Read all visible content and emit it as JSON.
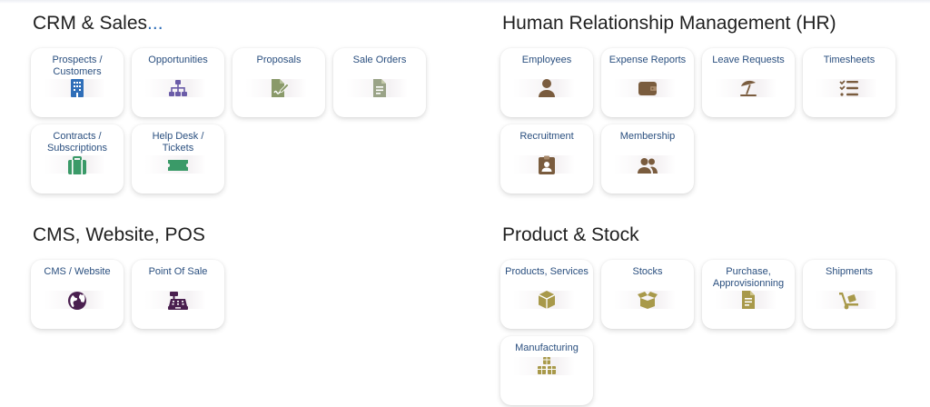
{
  "sections": {
    "crm": {
      "title": "CRM & Sales",
      "title_suffix": "...",
      "tiles": [
        {
          "label": "Prospects / Customers",
          "icon": "building-icon",
          "color": "#2f6eb8"
        },
        {
          "label": "Opportunities",
          "icon": "sitemap-icon",
          "color": "#6b5ca8"
        },
        {
          "label": "Proposals",
          "icon": "file-signature-icon",
          "color": "#8a9a6a"
        },
        {
          "label": "Sale Orders",
          "icon": "file-invoice-icon",
          "color": "#9aa387"
        },
        {
          "label": "Contracts / Subscriptions",
          "icon": "suitcase-icon",
          "color": "#3a9a68"
        },
        {
          "label": "Help Desk / Tickets",
          "icon": "ticket-icon",
          "color": "#3a9a68"
        }
      ]
    },
    "hr": {
      "title": "Human Relationship Management (HR)",
      "tiles": [
        {
          "label": "Employees",
          "icon": "user-icon",
          "color": "#7a5c3e"
        },
        {
          "label": "Expense Reports",
          "icon": "wallet-icon",
          "color": "#7a5c3e"
        },
        {
          "label": "Leave Requests",
          "icon": "umbrella-beach-icon",
          "color": "#7a5c3e"
        },
        {
          "label": "Timesheets",
          "icon": "tasks-icon",
          "color": "#7a5c3e"
        },
        {
          "label": "Recruitment",
          "icon": "id-badge-icon",
          "color": "#7a5c3e"
        },
        {
          "label": "Membership",
          "icon": "users-icon",
          "color": "#7a5c3e"
        }
      ]
    },
    "cms": {
      "title": "CMS, Website, POS",
      "tiles": [
        {
          "label": "CMS / Website",
          "icon": "globe-icon",
          "color": "#4a1f4f"
        },
        {
          "label": "Point Of Sale",
          "icon": "cash-register-icon",
          "color": "#4a1f4f"
        }
      ]
    },
    "product": {
      "title": "Product & Stock",
      "tiles": [
        {
          "label": "Products, Services",
          "icon": "cube-icon",
          "color": "#a8994a"
        },
        {
          "label": "Stocks",
          "icon": "box-open-icon",
          "color": "#a8994a"
        },
        {
          "label": "Purchase, Approvisionning",
          "icon": "file-invoice-icon",
          "color": "#a8994a"
        },
        {
          "label": "Shipments",
          "icon": "dolly-icon",
          "color": "#a8994a"
        },
        {
          "label": "Manufacturing",
          "icon": "cubes-icon",
          "color": "#a8994a"
        }
      ]
    }
  }
}
